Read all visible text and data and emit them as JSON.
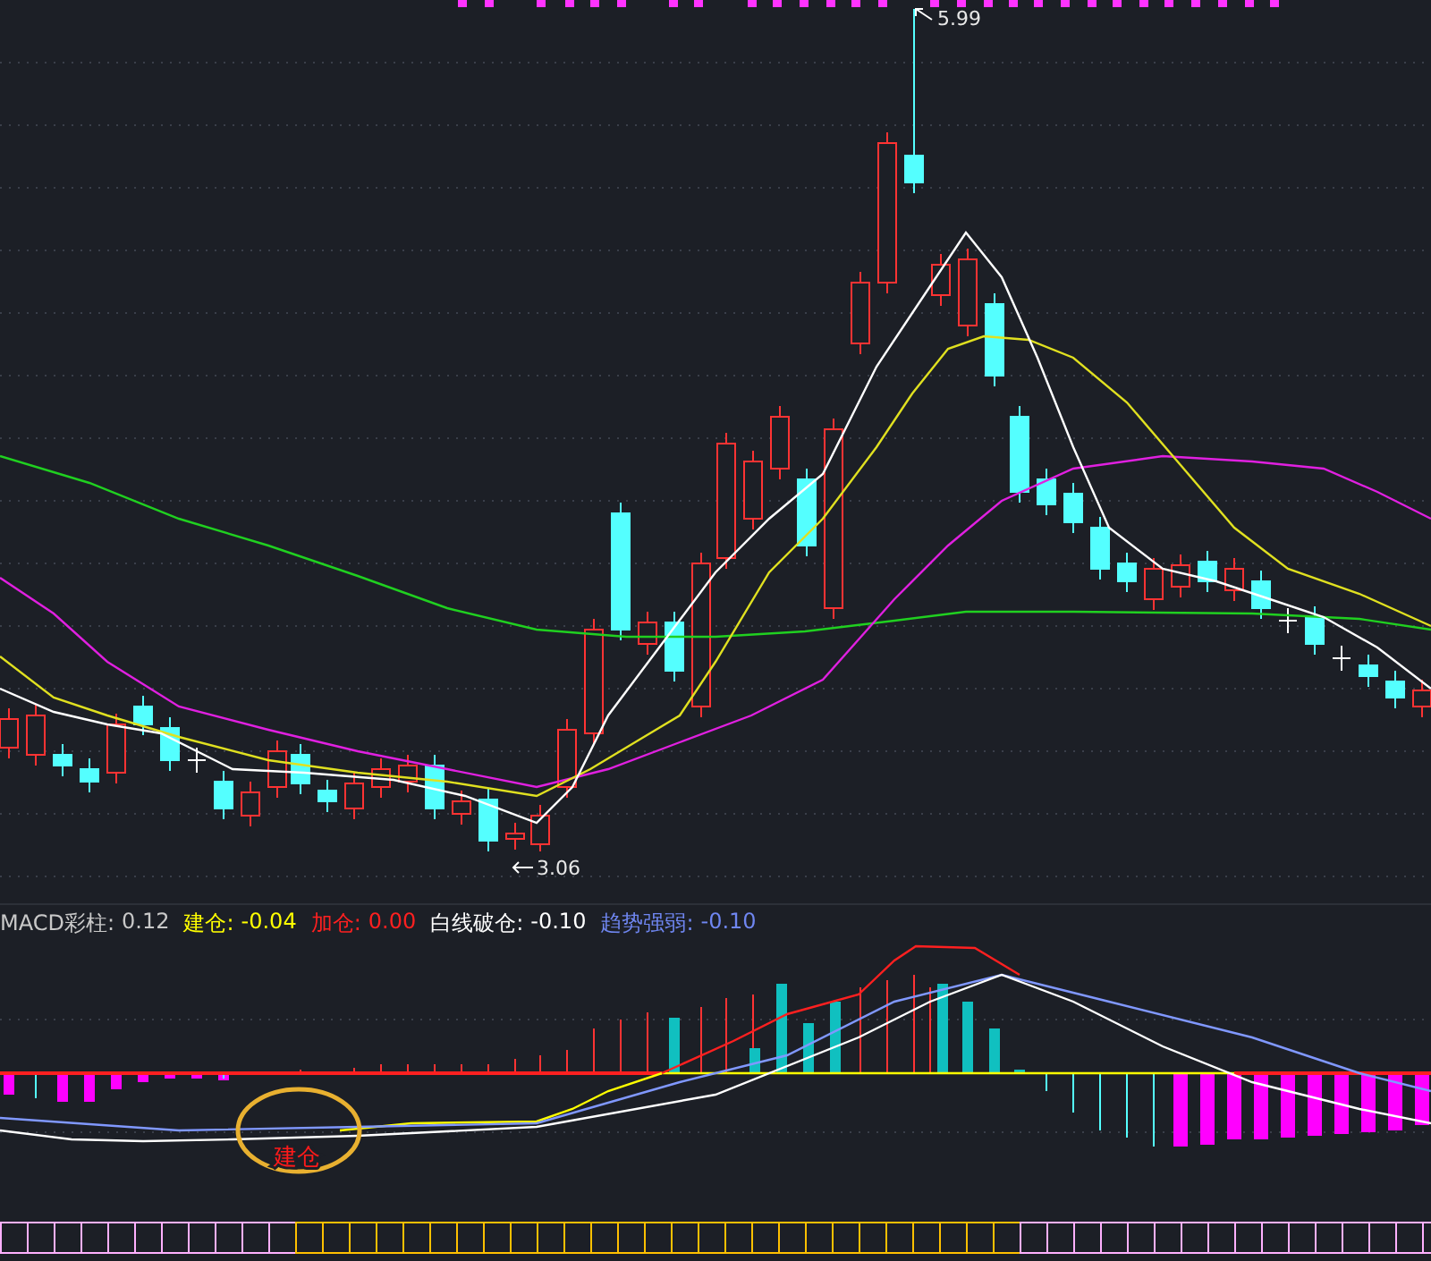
{
  "price_chart": {
    "high_label": "5.99",
    "low_label": "3.06"
  },
  "indicator": {
    "legend": [
      {
        "name": "MACD彩柱:",
        "value": "0.12",
        "color": "#c8c8c8"
      },
      {
        "name": "建仓:",
        "value": "-0.04",
        "color": "#ffff00"
      },
      {
        "name": "加仓:",
        "value": "0.00",
        "color": "#ff2020"
      },
      {
        "name": "白线破仓:",
        "value": "-0.10",
        "color": "#ffffff"
      },
      {
        "name": "趋势强弱:",
        "value": "-0.10",
        "color": "#6f86f0"
      }
    ],
    "signal_label": "建仓"
  }
}
